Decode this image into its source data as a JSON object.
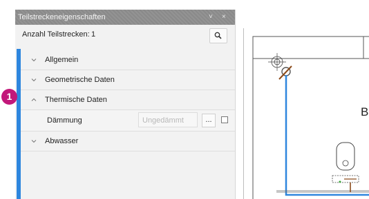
{
  "panel": {
    "title": "Teilstreckeneigenschaften",
    "title_controls": [
      "˅",
      "×"
    ],
    "count_label": "Anzahl Teilstrecken:",
    "count_value": "1",
    "sections": [
      {
        "label": "Allgemein",
        "expanded": false
      },
      {
        "label": "Geometrische Daten",
        "expanded": false
      },
      {
        "label": "Thermische Daten",
        "expanded": true
      },
      {
        "label": "Abwasser",
        "expanded": false
      }
    ],
    "thermal": {
      "property_label": "Dämmung",
      "property_placeholder": "Ungedämmt",
      "ellipsis_label": "..."
    }
  },
  "callout": {
    "number": "1"
  },
  "drawing": {
    "label": "B"
  },
  "colors": {
    "accent": "#2e86de",
    "badge": "#c2187a",
    "pipe": "#2e86de"
  }
}
